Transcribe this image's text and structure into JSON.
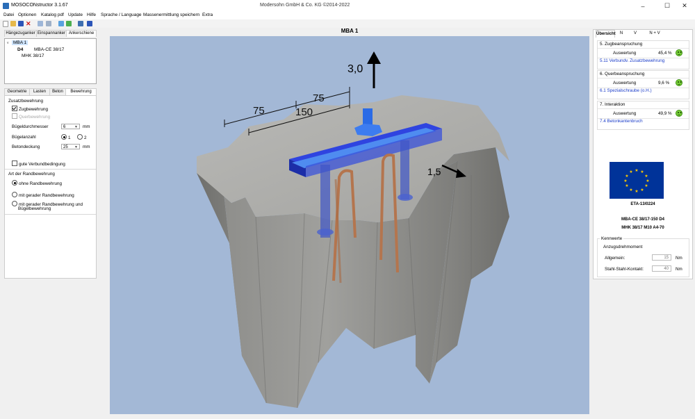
{
  "window": {
    "title": "MOSOCONstructor 3.1.67",
    "company": "Modersohn GmbH & Co. KG   ©2014-2022",
    "controls": {
      "minimize": "–",
      "maximize": "☐",
      "close": "✕"
    }
  },
  "menu": [
    "Datei",
    "Optionen",
    "Katalog pdf",
    "Update",
    "Hilfe",
    "Sprache / Language",
    "Massenermittlung speichern",
    "Extra"
  ],
  "left_tabs": [
    "Hängezuganker",
    "Einspannanker",
    "Ankerschiene"
  ],
  "tree": {
    "root": "MBA 1",
    "child1_code": "D4",
    "child1_label": "MBA-CE 38/17",
    "child2": "MHK 38/17"
  },
  "prop_tabs": [
    "Geometrie",
    "Lasten",
    "Beton",
    "Bewehrung"
  ],
  "bewehrung": {
    "group_title": "Zusatzbewehrung",
    "zugbewehrung": "Zugbewehrung",
    "querbewehrung": "Querbewehrung",
    "buegeldurchmesser_label": "Bügeldurchmesser",
    "buegeldurchmesser_value": "6",
    "buegeldurchmesser_unit": "mm",
    "buegelanzahl_label": "Bügelanzahl",
    "buegelanzahl_opt1": "1",
    "buegelanzahl_opt2": "2",
    "betondeckung_label": "Betondeckung",
    "betondeckung_value": "25",
    "betondeckung_unit": "mm",
    "verbund": "gute Verbundbedingung",
    "randbewehrung_title": "Art der Randbewehrung",
    "rand_opt1": "ohne Randbewehrung",
    "rand_opt2": "mit gerader Randbewehrung",
    "rand_opt3_line1": "mit gerader Randbewehrung und",
    "rand_opt3_line2": "Bügelbewehrung"
  },
  "viewport": {
    "title": "MBA 1",
    "force_vertical": "3,0",
    "force_horizontal": "1,5",
    "dim_75_left": "75",
    "dim_75_right": "75",
    "dim_150": "150"
  },
  "right_tabs": [
    "Übersicht",
    "N",
    "V",
    "N + V"
  ],
  "checks": [
    {
      "head": "5. Zugbeanspruchung",
      "label": "Auswertung",
      "pct": "45,4 %",
      "link": "5.11 Verbundv. Zusatzbewehrung"
    },
    {
      "head": "6. Querbeanspruchung",
      "label": "Auswertung",
      "pct": "9,6 %",
      "link": "6.1 Spezialschraube (o.H.)"
    },
    {
      "head": "7. Interaktion",
      "label": "Auswertung",
      "pct": "49,9 %",
      "link": "7.4 Betonkantenbruch"
    }
  ],
  "eta": "ETA-13/0224",
  "product_line1": "MBA-CE 38/17-150 D4",
  "product_line2": "MHK 38/17 M10 A4-70",
  "kennwerte": {
    "title": "Kennwerte",
    "anzug": "Anzugsdrehmoment",
    "allgemein_label": "Allgemein:",
    "allgemein_value": "15",
    "kontakt_label": "Stahl-Stahl-Kontakt:",
    "kontakt_value": "40",
    "unit": "Nm"
  },
  "colors": {
    "viewport_bg": "#a3b8d6",
    "link": "#1a3cc9",
    "ok_green": "#7ad13a",
    "eu_blue": "#003399",
    "eu_star": "#ffcc00"
  }
}
